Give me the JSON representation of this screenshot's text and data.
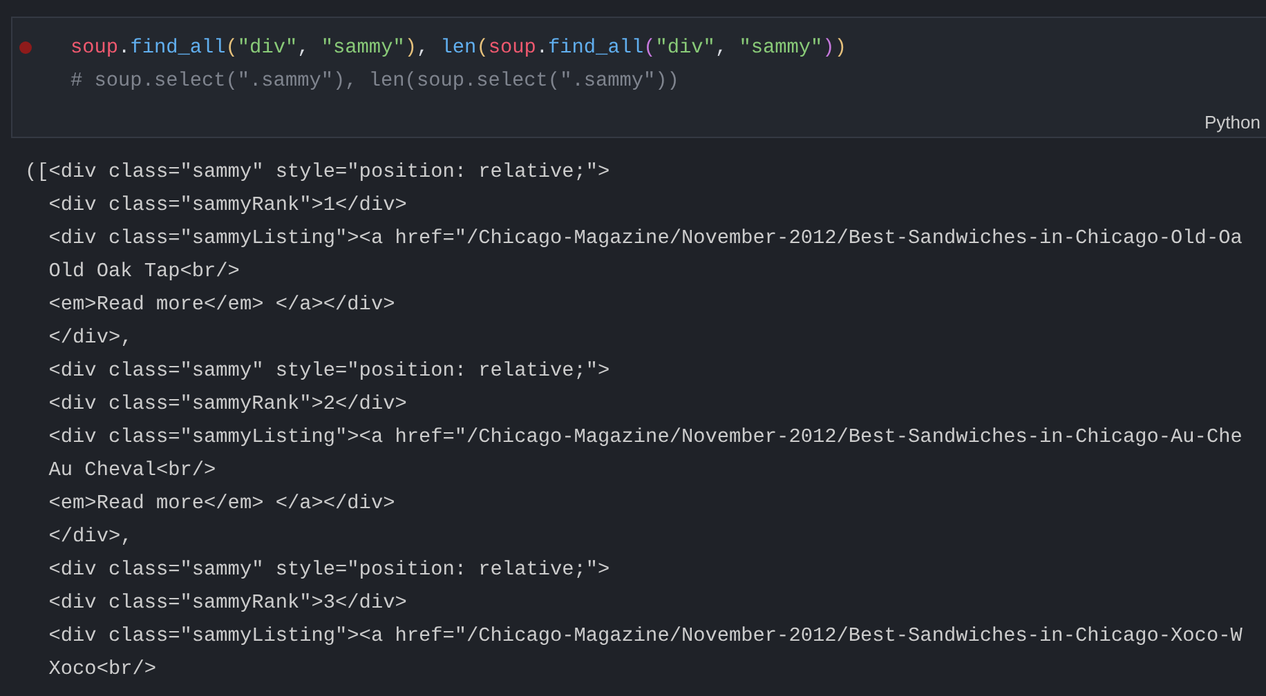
{
  "code_cell": {
    "breakpoint": true,
    "lines": [
      [
        {
          "text": "soup",
          "kind": "var"
        },
        {
          "text": ".",
          "kind": "plain"
        },
        {
          "text": "find_all",
          "kind": "func"
        },
        {
          "text": "(",
          "kind": "paren1"
        },
        {
          "text": "\"div\"",
          "kind": "string"
        },
        {
          "text": ", ",
          "kind": "plain"
        },
        {
          "text": "\"sammy\"",
          "kind": "string"
        },
        {
          "text": ")",
          "kind": "paren1"
        },
        {
          "text": ", ",
          "kind": "plain"
        },
        {
          "text": "len",
          "kind": "func"
        },
        {
          "text": "(",
          "kind": "paren1"
        },
        {
          "text": "soup",
          "kind": "var"
        },
        {
          "text": ".",
          "kind": "plain"
        },
        {
          "text": "find_all",
          "kind": "func"
        },
        {
          "text": "(",
          "kind": "paren2"
        },
        {
          "text": "\"div\"",
          "kind": "string"
        },
        {
          "text": ", ",
          "kind": "plain"
        },
        {
          "text": "\"sammy\"",
          "kind": "string"
        },
        {
          "text": ")",
          "kind": "paren2"
        },
        {
          "text": ")",
          "kind": "paren1"
        }
      ],
      [
        {
          "text": "# soup.select(\".sammy\"), len(soup.select(\".sammy\"))",
          "kind": "comment"
        }
      ]
    ],
    "language": "Python"
  },
  "output_lines": [
    "([<div class=\"sammy\" style=\"position: relative;\">",
    "  <div class=\"sammyRank\">1</div>",
    "  <div class=\"sammyListing\"><a href=\"/Chicago-Magazine/November-2012/Best-Sandwiches-in-Chicago-Old-Oa",
    "  Old Oak Tap<br/>",
    "  <em>Read more</em> </a></div>",
    "  </div>,",
    "  <div class=\"sammy\" style=\"position: relative;\">",
    "  <div class=\"sammyRank\">2</div>",
    "  <div class=\"sammyListing\"><a href=\"/Chicago-Magazine/November-2012/Best-Sandwiches-in-Chicago-Au-Che",
    "  Au Cheval<br/>",
    "  <em>Read more</em> </a></div>",
    "  </div>,",
    "  <div class=\"sammy\" style=\"position: relative;\">",
    "  <div class=\"sammyRank\">3</div>",
    "  <div class=\"sammyListing\"><a href=\"/Chicago-Magazine/November-2012/Best-Sandwiches-in-Chicago-Xoco-W",
    "  Xoco<br/>"
  ]
}
